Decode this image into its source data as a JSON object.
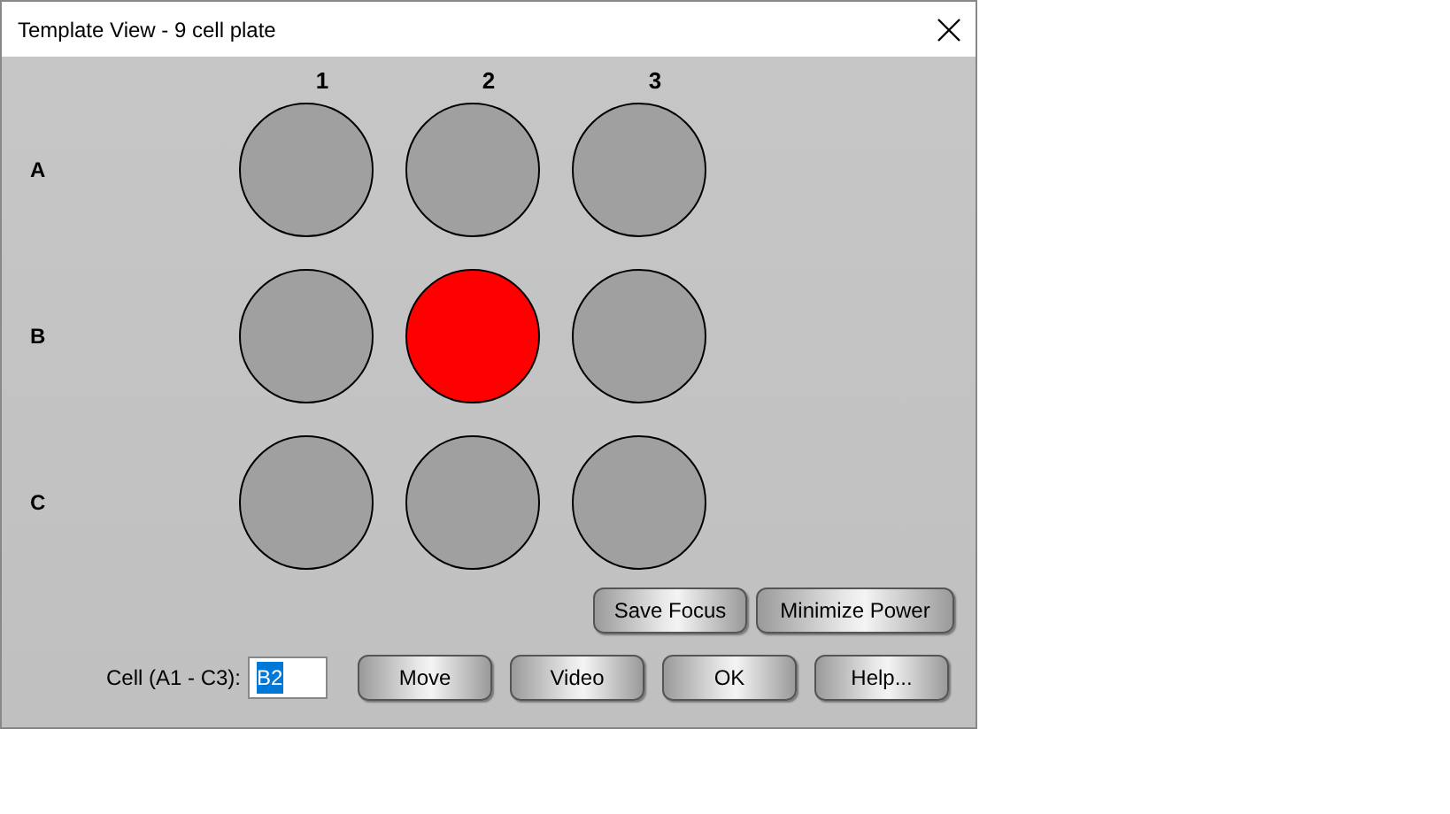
{
  "window": {
    "title": "Template View - 9 cell plate"
  },
  "plate": {
    "columns": [
      "1",
      "2",
      "3"
    ],
    "rows": [
      {
        "label": "A",
        "wells": [
          {
            "selected": false
          },
          {
            "selected": false
          },
          {
            "selected": false
          }
        ]
      },
      {
        "label": "B",
        "wells": [
          {
            "selected": false
          },
          {
            "selected": true
          },
          {
            "selected": false
          }
        ]
      },
      {
        "label": "C",
        "wells": [
          {
            "selected": false
          },
          {
            "selected": false
          },
          {
            "selected": false
          }
        ]
      }
    ]
  },
  "actions": [
    "Save Focus",
    "Minimize Power"
  ],
  "cell_field": {
    "label": "Cell (A1 - C3):",
    "value": "B2",
    "value_selected": true
  },
  "buttons": [
    "Move",
    "Video",
    "OK",
    "Help..."
  ]
}
